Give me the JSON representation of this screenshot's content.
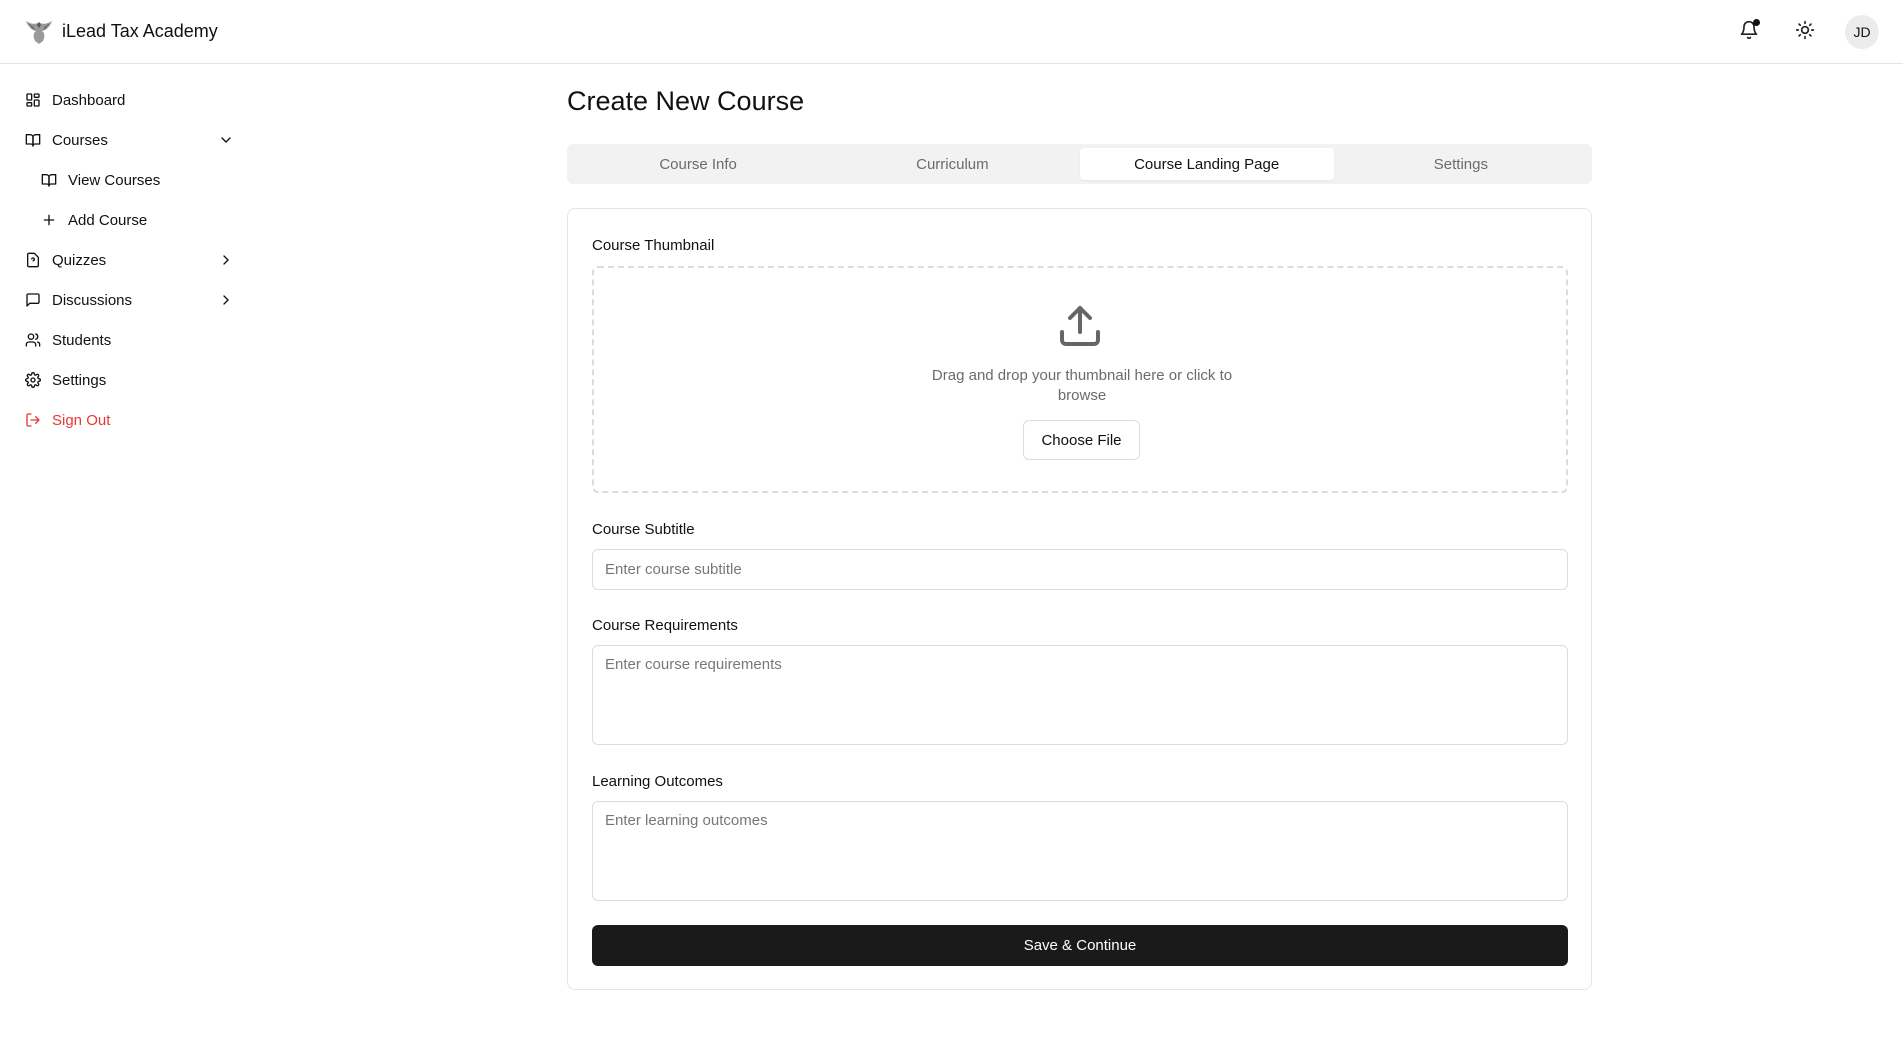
{
  "app": {
    "brand_name": "iLead Tax Academy",
    "logo_icon": "eagle-logo-icon"
  },
  "header": {
    "notifications_icon": "bell-icon",
    "has_unread": true,
    "theme_icon": "sun-icon",
    "avatar_initials": "JD"
  },
  "sidebar": {
    "items": [
      {
        "label": "Dashboard",
        "icon": "dashboard-icon"
      },
      {
        "label": "Courses",
        "icon": "book-open-icon",
        "expanded": true
      },
      {
        "label": "View Courses",
        "icon": "book-open-icon"
      },
      {
        "label": "Add Course",
        "icon": "plus-icon"
      },
      {
        "label": "Quizzes",
        "icon": "file-question-icon",
        "expanded": false
      },
      {
        "label": "Discussions",
        "icon": "message-square-icon",
        "expanded": false
      },
      {
        "label": "Students",
        "icon": "users-icon"
      },
      {
        "label": "Settings",
        "icon": "gear-icon"
      },
      {
        "label": "Sign Out",
        "icon": "log-out-icon"
      }
    ]
  },
  "main": {
    "title": "Create New Course",
    "tabs": [
      {
        "label": "Course Info",
        "active": false
      },
      {
        "label": "Curriculum",
        "active": false
      },
      {
        "label": "Course Landing Page",
        "active": true
      },
      {
        "label": "Settings",
        "active": false
      }
    ],
    "form": {
      "thumbnail": {
        "label": "Course Thumbnail",
        "drop_text": "Drag and drop your thumbnail here or click to browse",
        "button_label": "Choose File"
      },
      "subtitle": {
        "label": "Course Subtitle",
        "placeholder": "Enter course subtitle",
        "value": ""
      },
      "requirements": {
        "label": "Course Requirements",
        "placeholder": "Enter course requirements",
        "value": ""
      },
      "outcomes": {
        "label": "Learning Outcomes",
        "placeholder": "Enter learning outcomes",
        "value": ""
      },
      "submit_label": "Save & Continue"
    }
  },
  "colors": {
    "primary": "#1a1a1a",
    "danger": "#e53935",
    "muted_text": "#6b6b6b",
    "border": "#dcdcdc"
  }
}
